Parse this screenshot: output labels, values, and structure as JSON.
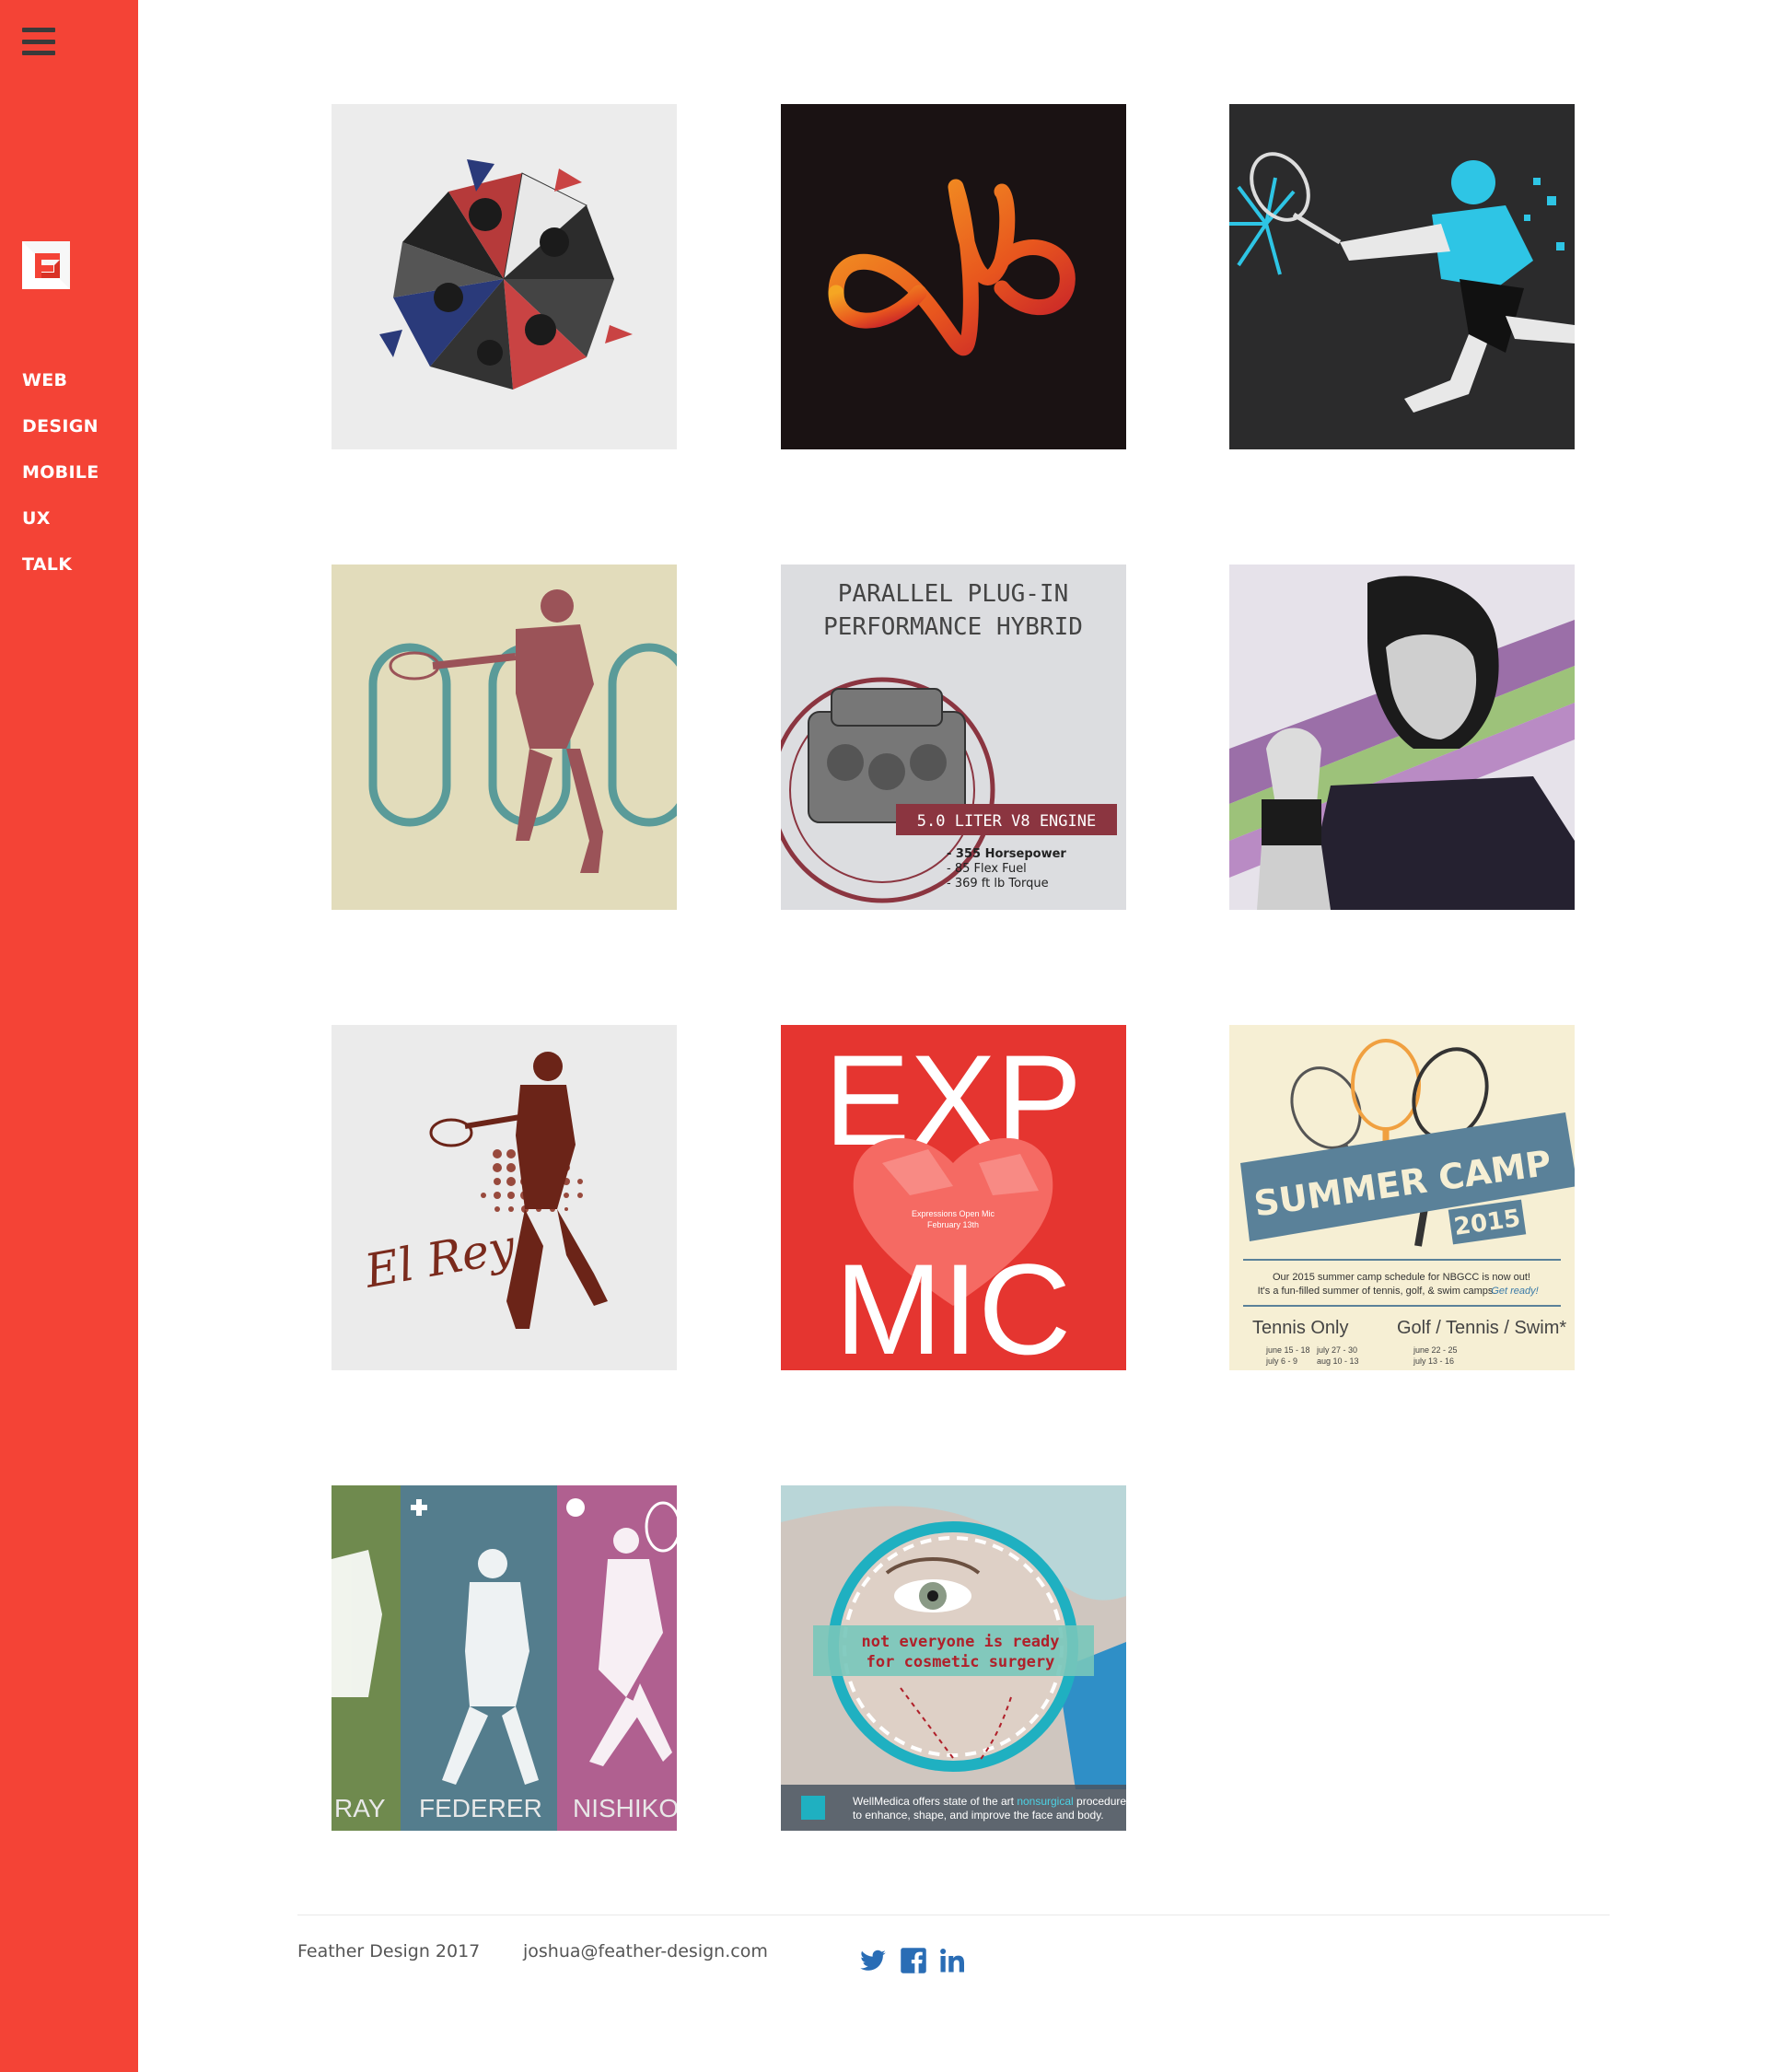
{
  "sidebar": {
    "nav": [
      {
        "label": "WEB"
      },
      {
        "label": "DESIGN"
      },
      {
        "label": "MOBILE"
      },
      {
        "label": "UX"
      },
      {
        "label": "TALK"
      }
    ]
  },
  "portfolio": {
    "hybrid": {
      "title_line1": "PARALLEL PLUG-IN",
      "title_line2": "PERFORMANCE HYBRID",
      "engine": "5.0 LITER V8 ENGINE",
      "spec1": "- 355 Horsepower",
      "spec2": "- 85 Flex Fuel",
      "spec3": "- 369 ft lb Torque"
    },
    "elrey": {
      "script": "El Rey"
    },
    "openmic": {
      "word1": "EXP",
      "word2": "MIC",
      "line1": "Expressions Open Mic",
      "line2": "February 13th"
    },
    "summercamp": {
      "banner": "SUMMER CAMP",
      "year": "2015",
      "text1": "Our 2015 summer camp schedule for NBGCC is now out!",
      "text2": "It's a fun-filled summer of tennis, golf, & swim camps.",
      "text3": "Get ready!",
      "col1": "Tennis Only",
      "col2": "Golf / Tennis / Swim*",
      "d1": "june 15 - 18",
      "d2": "july 27 - 30",
      "d3": "june 22 - 25",
      "d4": "july 6 - 9",
      "d5": "aug 10 - 13",
      "d6": "july 13 - 16"
    },
    "players": {
      "n1": "RAY",
      "n2": "FEDERER",
      "n3": "NISHIKO"
    },
    "wellmedica": {
      "line1": "not everyone is ready",
      "line2": "for cosmetic surgery",
      "info1a": "WellMedica offers state of the art ",
      "info1b": "nonsurgical",
      "info1c": " procedures",
      "info2": "to enhance, shape, and improve the face and body."
    }
  },
  "footer": {
    "copyright": "Feather Design 2017",
    "email": "joshua@feather-design.com"
  },
  "colors": {
    "sidebar": "#f44336",
    "social": "#2a6db5",
    "menu_icon": "#3a3a3a"
  },
  "icons": [
    "menu-icon",
    "feather-logo",
    "twitter-icon",
    "facebook-icon",
    "linkedin-icon"
  ]
}
